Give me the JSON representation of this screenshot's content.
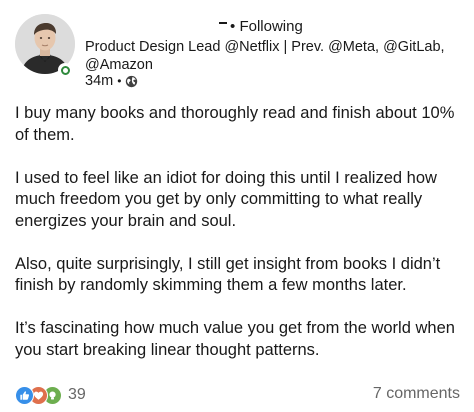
{
  "author": {
    "follow_status": "Following",
    "follow_prefix": "•",
    "headline": "Product Design Lead @Netflix | Prev. @Meta, @GitLab, @Amazon",
    "timestamp": "34m",
    "meta_separator": "•",
    "visibility_icon": "globe-icon"
  },
  "post": {
    "paragraphs": [
      "I buy many books and thoroughly read and finish about 10% of them.",
      "I used to feel like an idiot for doing this until I realized how much freedom you get by only committing to what really energizes your brain and soul.",
      "Also, quite surprisingly, I still get insight from books I didn’t finish by randomly skimming them a few months later.",
      "It’s fascinating how much value you get from the world when you start breaking linear thought patterns."
    ]
  },
  "engagement": {
    "reaction_icons": [
      "like-icon",
      "love-icon",
      "insightful-icon"
    ],
    "reaction_count": "39",
    "comments": "7 comments"
  },
  "colors": {
    "like": "#378fe9",
    "love": "#df704d",
    "insightful": "#6dae4f",
    "presence": "#2f8a3c",
    "secondary_text": "#666666"
  }
}
